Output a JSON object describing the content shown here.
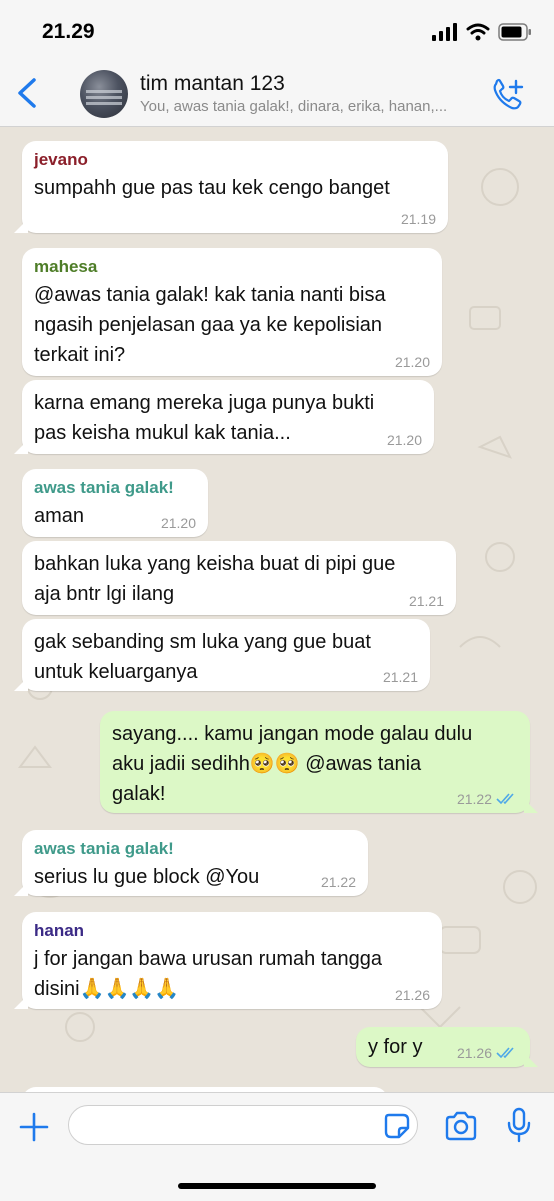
{
  "status_bar": {
    "time": "21.29"
  },
  "header": {
    "group_name": "tim mantan 123",
    "members": "You, awas tania galak!, dinara, erika, hanan,..."
  },
  "messages": [
    {
      "direction": "in",
      "sender": "jevano",
      "sender_color": "#8b1f2a",
      "text": "sumpahh gue pas tau kek cengo banget",
      "time": "21.19"
    },
    {
      "direction": "in",
      "sender": "mahesa",
      "sender_color": "#4e7d28",
      "text": "@awas tania galak! kak tania nanti bisa\nngasih penjelasan gaa ya ke kepolisian\nterkait ini?",
      "time": "21.20"
    },
    {
      "direction": "in",
      "text": "karna emang mereka juga punya bukti\npas keisha mukul kak tania...",
      "time": "21.20"
    },
    {
      "direction": "in",
      "sender": "awas tania galak!",
      "sender_color": "#3f9a8a",
      "text": "aman",
      "time": "21.20"
    },
    {
      "direction": "in",
      "text": "bahkan luka yang keisha buat di pipi gue\naja bntr lgi ilang",
      "time": "21.21"
    },
    {
      "direction": "in",
      "text": "gak sebanding sm luka yang gue buat\nuntuk keluarganya",
      "time": "21.21"
    },
    {
      "direction": "out",
      "text": "sayang.... kamu jangan mode galau dulu\naku jadii sedihh🥺🥺 @awas tania\ngalak!",
      "time": "21.22"
    },
    {
      "direction": "in",
      "sender": "awas tania galak!",
      "sender_color": "#3f9a8a",
      "text": "serius lu gue block @You",
      "time": "21.22"
    },
    {
      "direction": "in",
      "sender": "hanan",
      "sender_color": "#3b2a86",
      "text": "j for jangan bawa urusan rumah tangga\ndisini🙏🙏🙏🙏",
      "time": "21.26"
    },
    {
      "direction": "out",
      "text": "y for y",
      "time": "21.26"
    }
  ],
  "input": {
    "placeholder": ""
  },
  "icons": {
    "back": "chevron-left-icon",
    "call": "add-call-icon",
    "plus": "plus-icon",
    "sticker": "sticker-icon",
    "camera": "camera-icon",
    "mic": "microphone-icon",
    "read_receipt": "double-check-icon"
  },
  "colors": {
    "accent": "#1f7aec",
    "outgoing": "#dcf8c6",
    "incoming": "#ffffff",
    "read_tick": "#4fa8e8"
  }
}
